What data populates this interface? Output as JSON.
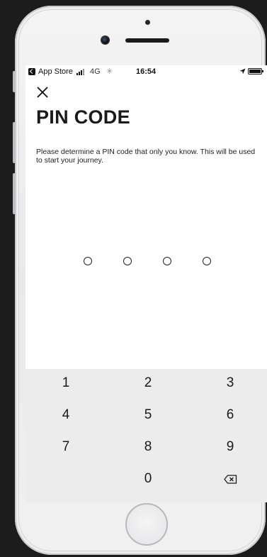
{
  "status_bar": {
    "back_app": "App Store",
    "network": "4G",
    "time": "16:54"
  },
  "header": {
    "close_icon": "close-x-icon",
    "title": "PIN CODE"
  },
  "description": "Please determine a PIN code that only you know. This will be used to start your journey.",
  "pin": {
    "length": 4,
    "entered": 0
  },
  "keypad": {
    "keys": [
      "1",
      "2",
      "3",
      "4",
      "5",
      "6",
      "7",
      "8",
      "9",
      "",
      "0",
      "backspace"
    ],
    "backspace_icon": "backspace-icon"
  },
  "colors": {
    "text": "#1a1a1a",
    "keypad_bg": "#ececec",
    "screen_bg": "#ffffff",
    "device_bg": "#1c1c1c"
  }
}
